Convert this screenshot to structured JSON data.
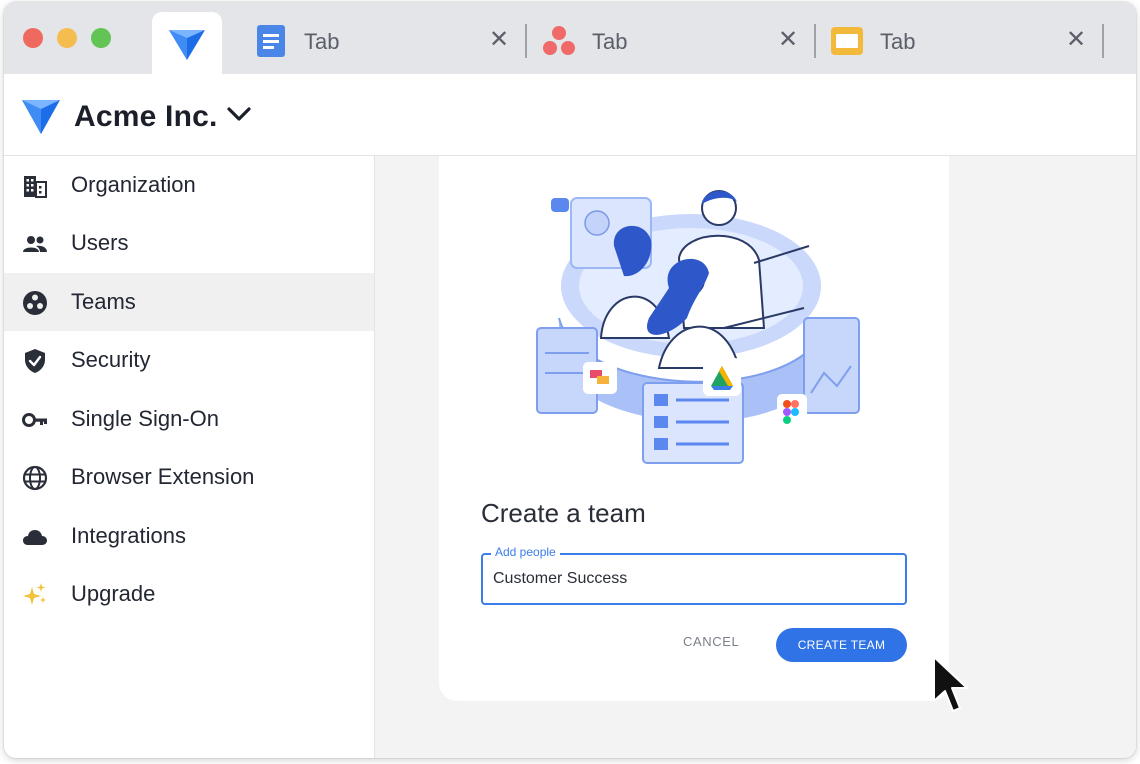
{
  "tabs": [
    {
      "label": "Tab",
      "icon": "google-docs-icon"
    },
    {
      "label": "Tab",
      "icon": "asana-icon"
    },
    {
      "label": "Tab",
      "icon": "google-slides-icon"
    }
  ],
  "header": {
    "org_name": "Acme Inc."
  },
  "sidebar": {
    "active": "Teams",
    "items": [
      {
        "label": "Organization",
        "icon": "building-icon"
      },
      {
        "label": "Users",
        "icon": "users-icon"
      },
      {
        "label": "Teams",
        "icon": "teams-icon"
      },
      {
        "label": "Security",
        "icon": "shield-icon"
      },
      {
        "label": "Single Sign-On",
        "icon": "key-icon"
      },
      {
        "label": "Browser Extension",
        "icon": "globe-icon"
      },
      {
        "label": "Integrations",
        "icon": "cloud-icon"
      },
      {
        "label": "Upgrade",
        "icon": "sparkles-icon"
      }
    ]
  },
  "dialog": {
    "title": "Create a team",
    "field_label": "Add people",
    "field_value": "Customer Success",
    "cancel_label": "CANCEL",
    "create_label": "CREATE TEAM"
  },
  "colors": {
    "accent": "#2f73e6",
    "field_border": "#3b7de9",
    "brand": "#1e6de8"
  }
}
